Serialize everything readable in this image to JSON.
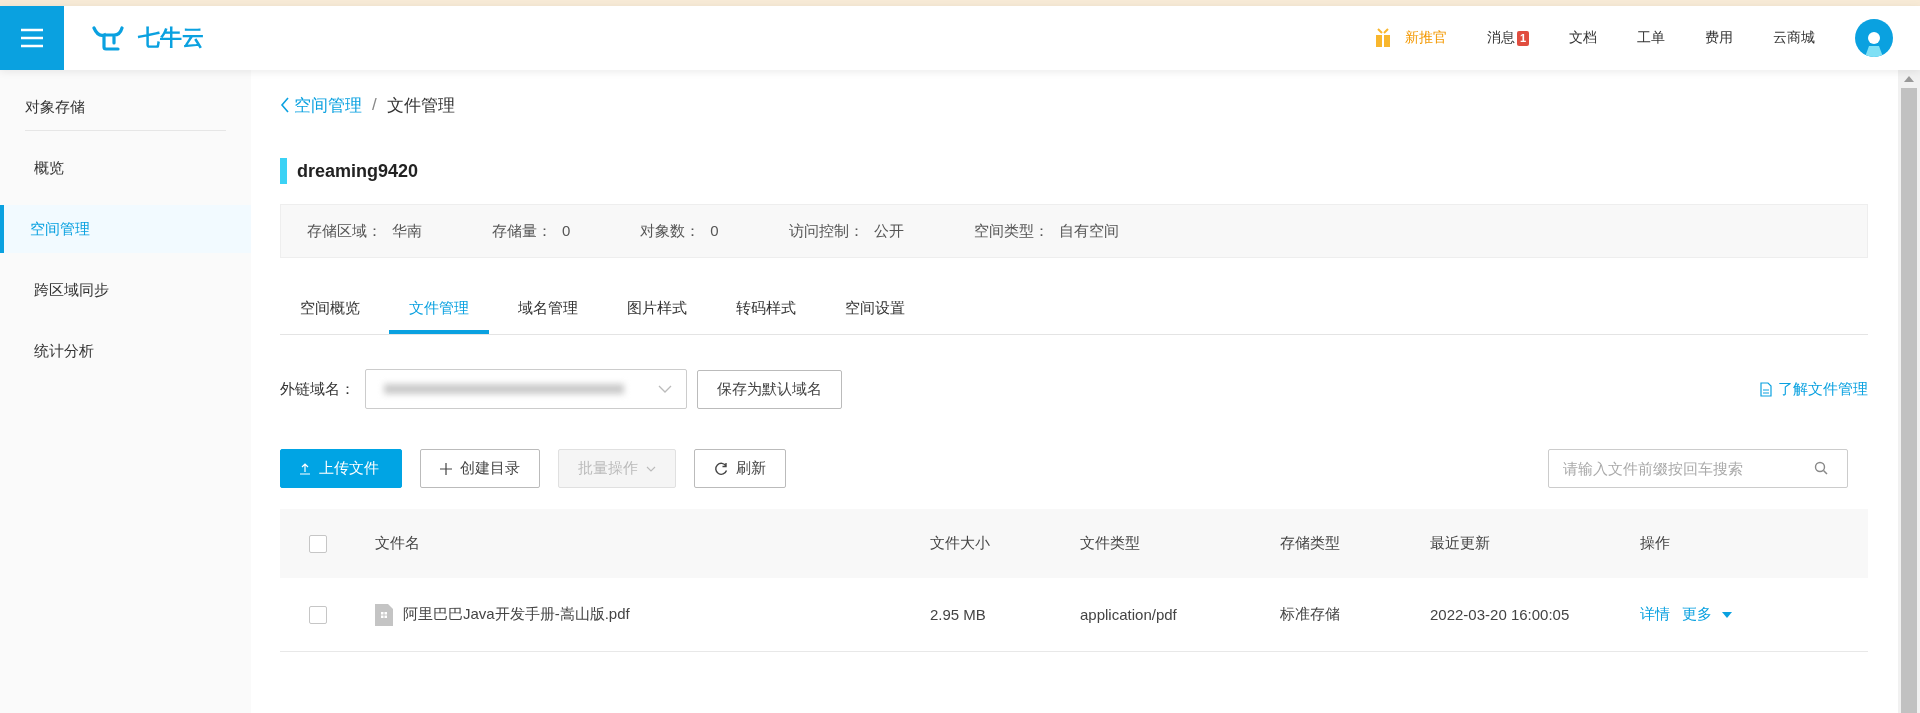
{
  "header": {
    "logo_text": "七牛云",
    "nav": [
      {
        "kind": "promo",
        "label": "新推官"
      },
      {
        "kind": "badge",
        "label": "消息",
        "badge": "1"
      },
      {
        "kind": "link",
        "label": "文档"
      },
      {
        "kind": "link",
        "label": "工单"
      },
      {
        "kind": "link",
        "label": "费用"
      },
      {
        "kind": "link",
        "label": "云商城"
      }
    ]
  },
  "sidebar": {
    "title": "对象存储",
    "items": [
      {
        "label": "概览",
        "selected": false
      },
      {
        "label": "空间管理",
        "selected": true
      },
      {
        "label": "跨区域同步",
        "selected": false
      },
      {
        "label": "统计分析",
        "selected": false
      }
    ]
  },
  "breadcrumb": {
    "parent": "空间管理",
    "separator": "/",
    "current": "文件管理"
  },
  "bucket": {
    "name": "dreaming9420",
    "info": [
      {
        "label": "存储区域：",
        "value": "华南"
      },
      {
        "label": "存储量：",
        "value": "0"
      },
      {
        "label": "对象数：",
        "value": "0"
      },
      {
        "label": "访问控制：",
        "value": "公开"
      },
      {
        "label": "空间类型：",
        "value": "自有空间"
      }
    ]
  },
  "tabs": [
    {
      "label": "空间概览",
      "selected": false
    },
    {
      "label": "文件管理",
      "selected": true
    },
    {
      "label": "域名管理",
      "selected": false
    },
    {
      "label": "图片样式",
      "selected": false
    },
    {
      "label": "转码样式",
      "selected": false
    },
    {
      "label": "空间设置",
      "selected": false
    }
  ],
  "domain": {
    "label": "外链域名：",
    "save_button": "保存为默认域名",
    "help_link": "了解文件管理"
  },
  "toolbar": {
    "buttons": [
      {
        "kind": "primary",
        "label": "上传文件",
        "disabled": false
      },
      {
        "kind": "add",
        "label": "创建目录",
        "disabled": false
      },
      {
        "kind": "dropdown",
        "label": "批量操作",
        "disabled": true
      },
      {
        "kind": "refresh",
        "label": "刷新",
        "disabled": false
      }
    ],
    "search_placeholder": "请输入文件前缀按回车搜索"
  },
  "table": {
    "header_checked": false,
    "columns": [
      "文件名",
      "文件大小",
      "文件类型",
      "存储类型",
      "最近更新",
      "操作"
    ],
    "rows": [
      {
        "checked": false,
        "name": "阿里巴巴Java开发手册-嵩山版.pdf",
        "size": "2.95 MB",
        "type": "application/pdf",
        "storage": "标准存储",
        "updated": "2022-03-20 16:00:05",
        "actions": [
          "详情",
          "更多"
        ]
      }
    ]
  }
}
